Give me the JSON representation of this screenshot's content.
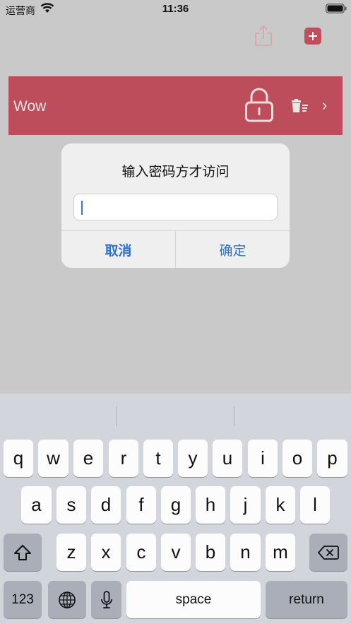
{
  "status_bar": {
    "carrier": "运营商",
    "time": "11:36"
  },
  "nav": {
    "share_icon": "share-icon",
    "add_icon": "plus-icon"
  },
  "list": {
    "rows": [
      {
        "title": "Wow",
        "lock_icon": "lock-icon",
        "delete_icon": "trash-icon",
        "chevron": "›"
      }
    ]
  },
  "alert": {
    "title": "输入密码方才访问",
    "input_value": "",
    "cancel_label": "取消",
    "ok_label": "确定"
  },
  "keyboard": {
    "row1": [
      "q",
      "w",
      "e",
      "r",
      "t",
      "y",
      "u",
      "i",
      "o",
      "p"
    ],
    "row2": [
      "a",
      "s",
      "d",
      "f",
      "g",
      "h",
      "j",
      "k",
      "l"
    ],
    "row3": [
      "z",
      "x",
      "c",
      "v",
      "b",
      "n",
      "m"
    ],
    "numbers_label": "123",
    "space_label": "space",
    "return_label": "return"
  },
  "colors": {
    "accent": "#be4d5b",
    "link": "#2b74d0"
  }
}
